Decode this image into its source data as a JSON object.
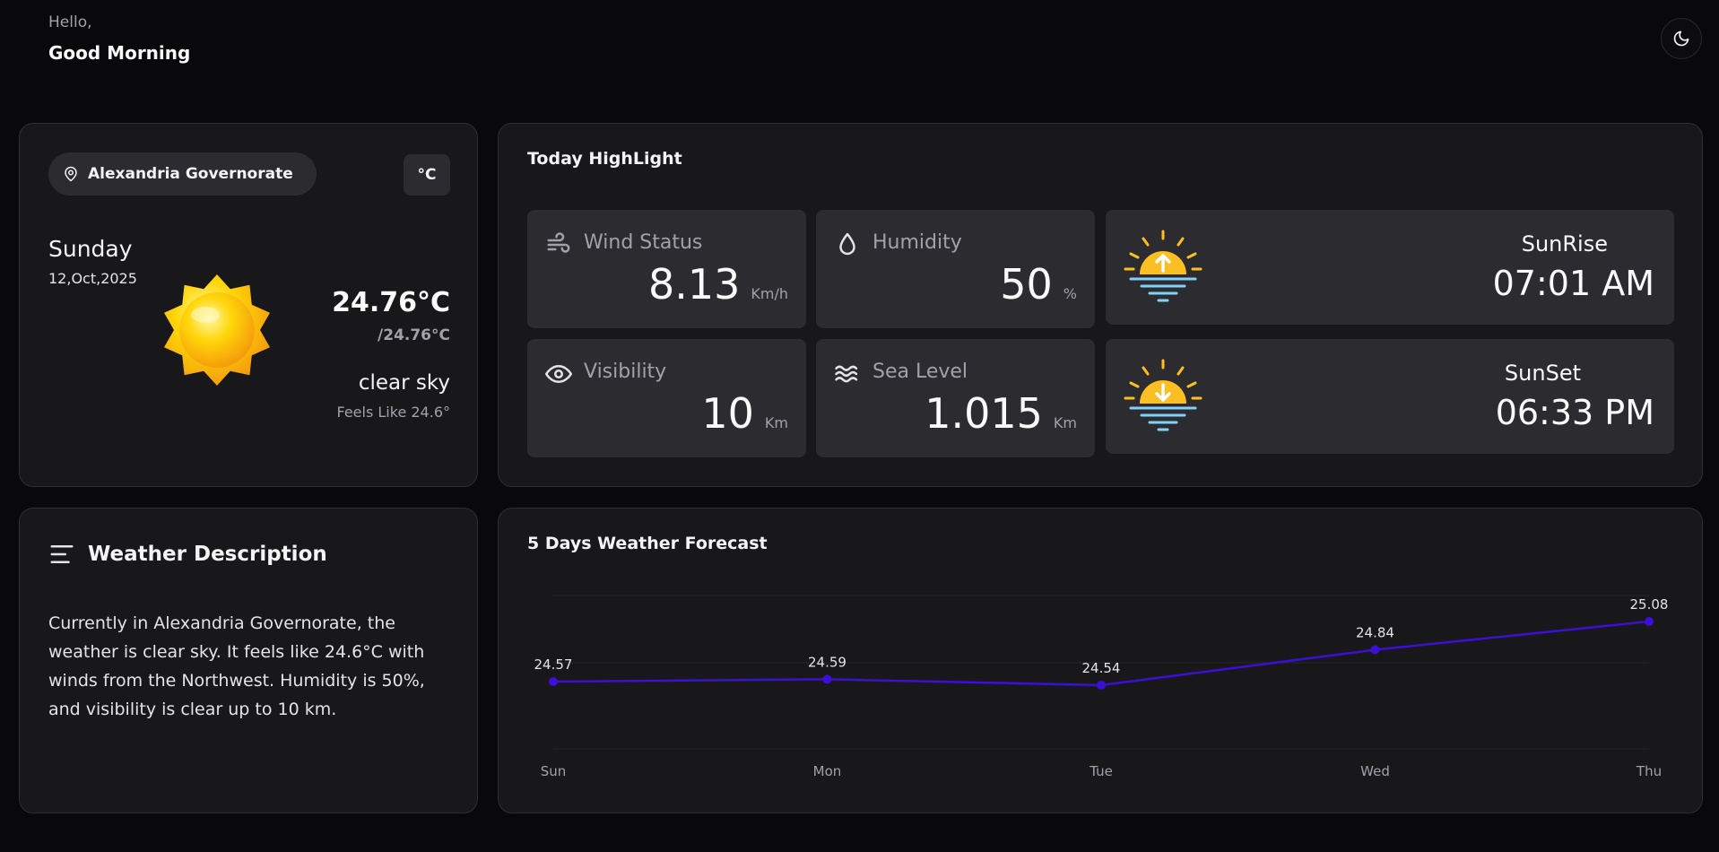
{
  "header": {
    "hello": "Hello,",
    "greeting": "Good Morning",
    "theme_icon": "moon-icon"
  },
  "current": {
    "location": "Alexandria Governorate",
    "location_icon": "map-pin-icon",
    "unit_toggle": "°C",
    "day": "Sunday",
    "date": "12,Oct,2025",
    "weather_icon": "sun-icon",
    "temp": "24.76°C",
    "temp_min": "/24.76°C",
    "condition": "clear sky",
    "feels_like": "Feels Like 24.6°"
  },
  "highlight": {
    "title": "Today HighLight",
    "wind": {
      "label": "Wind Status",
      "value": "8.13",
      "unit": "Km/h",
      "icon": "wind-icon"
    },
    "humidity": {
      "label": "Humidity",
      "value": "50",
      "unit": "%",
      "icon": "droplet-icon"
    },
    "visibility": {
      "label": "Visibility",
      "value": "10",
      "unit": "Km",
      "icon": "eye-icon"
    },
    "sea_level": {
      "label": "Sea Level",
      "value": "1.015",
      "unit": "Km",
      "icon": "waves-icon"
    },
    "sunrise": {
      "label": "SunRise",
      "time": "07:01 AM",
      "icon": "sunrise-icon"
    },
    "sunset": {
      "label": "SunSet",
      "time": "06:33 PM",
      "icon": "sunset-icon"
    }
  },
  "description": {
    "title": "Weather Description",
    "icon": "menu-lines-icon",
    "text": "Currently in Alexandria Governorate, the weather is clear sky. It feels like 24.6°C with winds from the Northwest. Humidity is 50%, and visibility is clear up to 10 km."
  },
  "forecast": {
    "title": "5 Days Weather Forecast"
  },
  "chart_data": {
    "type": "line",
    "categories": [
      "Sun",
      "Mon",
      "Tue",
      "Wed",
      "Thu"
    ],
    "series": [
      {
        "values": [
          24.57,
          24.59,
          24.54,
          24.84,
          25.08
        ],
        "color": "#3b0fd6"
      }
    ],
    "data_labels": [
      "24.57",
      "24.59",
      "24.54",
      "24.84",
      "25.08"
    ],
    "grid": true,
    "ylim": [
      24.0,
      25.3
    ]
  },
  "colors": {
    "background": "#09090b",
    "card": "#18181b",
    "tile": "#2c2c30",
    "line": "#3b0fd6",
    "sun": "#fbbf24",
    "water": "#7dd3fc"
  }
}
